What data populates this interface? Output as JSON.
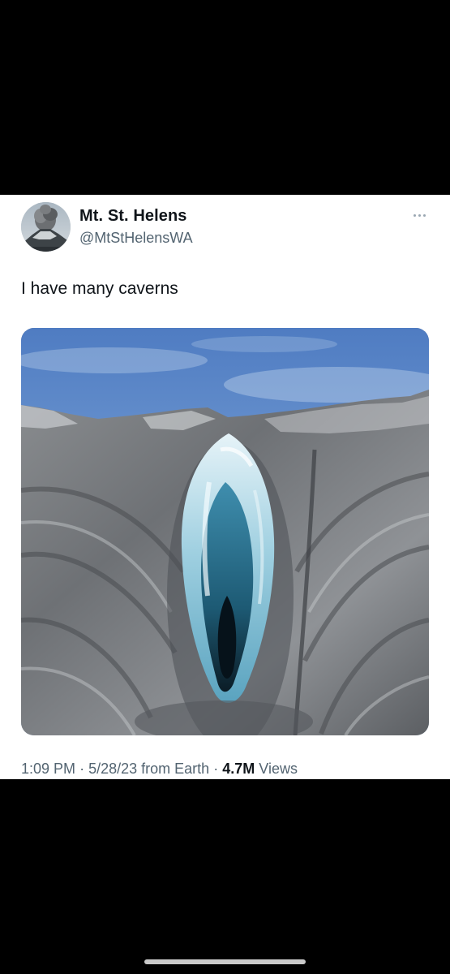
{
  "tweet": {
    "display_name": "Mt. St. Helens",
    "handle": "@MtStHelensWA",
    "text": "I have many caverns",
    "time": "1:09 PM",
    "date": "5/28/23",
    "source": "from Earth",
    "views_count": "4.7M",
    "views_label": "Views",
    "separator": "·"
  },
  "icons": {
    "more": "more-horizontal-icon",
    "avatar": "volcano-eruption-photo"
  },
  "colors": {
    "background": "#000000",
    "card": "#ffffff",
    "text_primary": "#0f1419",
    "text_secondary": "#536471"
  }
}
